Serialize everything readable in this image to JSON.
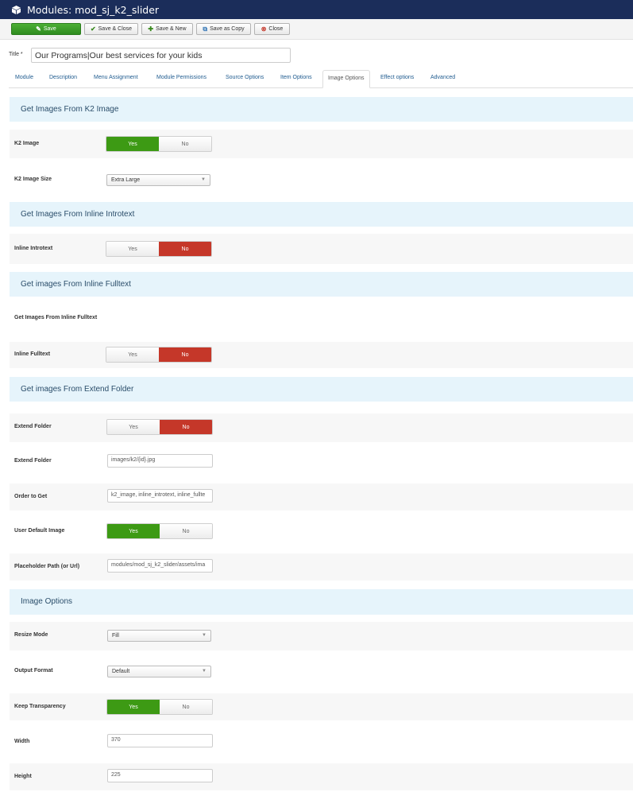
{
  "header": {
    "title": "Modules: mod_sj_k2_slider",
    "icon": "cube-icon"
  },
  "toolbar": {
    "save": "Save",
    "save_close": "Save & Close",
    "save_new": "Save & New",
    "save_copy": "Save as Copy",
    "close": "Close"
  },
  "title_field": {
    "label": "Title *",
    "value": "Our Programs|Our best services for your kids"
  },
  "tabs": [
    "Module",
    "Description",
    "Menu Assignment",
    "Module Permissions",
    "Source Options",
    "Item Options",
    "Image Options",
    "Effect options",
    "Advanced"
  ],
  "active_tab": "Image Options",
  "toggle_labels": {
    "yes": "Yes",
    "no": "No"
  },
  "sections": {
    "k2": "Get Images From K2 Image",
    "introtext": "Get Images From Inline Introtext",
    "fulltext": "Get images From Inline Fulltext",
    "extend": "Get images From Extend Folder",
    "image_options": "Image Options"
  },
  "fields": {
    "k2_image": {
      "label": "K2 Image",
      "value": "Yes"
    },
    "k2_image_size": {
      "label": "K2 Image Size",
      "value": "Extra Large"
    },
    "inline_introtext": {
      "label": "Inline Introtext",
      "value": "No"
    },
    "fulltext_heading": {
      "label": "Get Images From Inline Fulltext"
    },
    "inline_fulltext": {
      "label": "Inline Fulltext",
      "value": "No"
    },
    "extend_folder_toggle": {
      "label": "Extend Folder",
      "value": "No"
    },
    "extend_folder_path": {
      "label": "Extend Folder",
      "value": "images/k2/{id}.jpg"
    },
    "order_to_get": {
      "label": "Order to Get",
      "value": "k2_image, inline_introtext, inline_fullte"
    },
    "user_default_image": {
      "label": "User Default Image",
      "value": "Yes"
    },
    "placeholder_path": {
      "label": "Placeholder Path (or Url)",
      "value": "modules/mod_sj_k2_slider/assets/ima"
    },
    "resize_mode": {
      "label": "Resize Mode",
      "value": "Fill"
    },
    "output_format": {
      "label": "Output Format",
      "value": "Default"
    },
    "keep_transparency": {
      "label": "Keep Transparency",
      "value": "Yes"
    },
    "width": {
      "label": "Width",
      "value": "370"
    },
    "height": {
      "label": "Height",
      "value": "225"
    }
  },
  "colors": {
    "header_bg": "#1b2d5a",
    "section_bg": "#e6f4fb",
    "yes_active": "#3d9a14",
    "no_active": "#c53729",
    "save_bg": "#3c9b28"
  }
}
